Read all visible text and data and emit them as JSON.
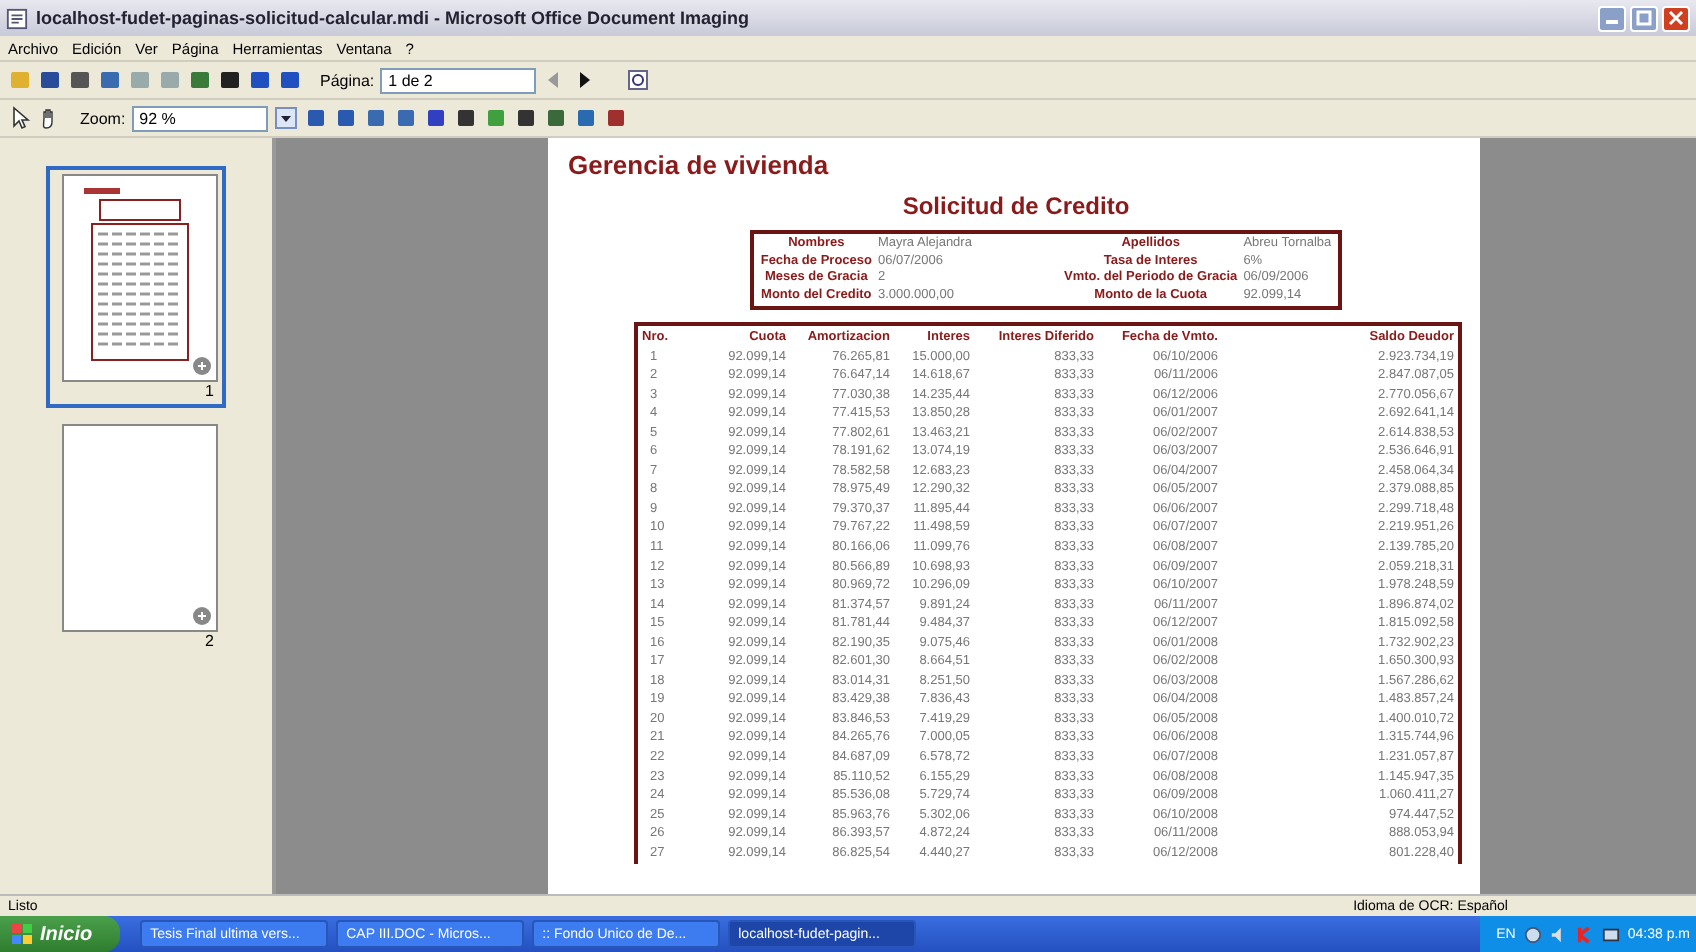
{
  "window": {
    "title": "localhost-fudet-paginas-solicitud-calcular.mdi - Microsoft Office Document Imaging"
  },
  "menu": [
    "Archivo",
    "Edición",
    "Ver",
    "Página",
    "Herramientas",
    "Ventana",
    "?"
  ],
  "toolbar": {
    "page_label": "Página:",
    "page_value": "1 de 2",
    "zoom_label": "Zoom:",
    "zoom_value": "92 %"
  },
  "thumbnails": [
    {
      "label": "1",
      "selected": true
    },
    {
      "label": "2",
      "selected": false
    }
  ],
  "document": {
    "heading": "Gerencia de vivienda",
    "title": "Solicitud de Credito",
    "fields": [
      {
        "label": "Nombres",
        "value": "Mayra Alejandra"
      },
      {
        "label": "Apellidos",
        "value": "Abreu Tornalba"
      },
      {
        "label": "Fecha de Proceso",
        "value": "06/07/2006"
      },
      {
        "label": "Tasa de Interes",
        "value": "6%"
      },
      {
        "label": "Meses de Gracia",
        "value": "2"
      },
      {
        "label": "Vmto. del Periodo de Gracia",
        "value": "06/09/2006"
      },
      {
        "label": "Monto del Credito",
        "value": "3.000.000,00"
      },
      {
        "label": "Monto de la Cuota",
        "value": "92.099,14"
      }
    ],
    "table": {
      "columns": [
        "Nro.",
        "Cuota",
        "Amortizacion",
        "Interes",
        "Interes Diferido",
        "Fecha de Vmto.",
        "Saldo Deudor"
      ],
      "rows": [
        [
          "1",
          "92.099,14",
          "76.265,81",
          "15.000,00",
          "833,33",
          "06/10/2006",
          "2.923.734,19"
        ],
        [
          "2",
          "92.099,14",
          "76.647,14",
          "14.618,67",
          "833,33",
          "06/11/2006",
          "2.847.087,05"
        ],
        [
          "3",
          "92.099,14",
          "77.030,38",
          "14.235,44",
          "833,33",
          "06/12/2006",
          "2.770.056,67"
        ],
        [
          "4",
          "92.099,14",
          "77.415,53",
          "13.850,28",
          "833,33",
          "06/01/2007",
          "2.692.641,14"
        ],
        [
          "5",
          "92.099,14",
          "77.802,61",
          "13.463,21",
          "833,33",
          "06/02/2007",
          "2.614.838,53"
        ],
        [
          "6",
          "92.099,14",
          "78.191,62",
          "13.074,19",
          "833,33",
          "06/03/2007",
          "2.536.646,91"
        ],
        [
          "7",
          "92.099,14",
          "78.582,58",
          "12.683,23",
          "833,33",
          "06/04/2007",
          "2.458.064,34"
        ],
        [
          "8",
          "92.099,14",
          "78.975,49",
          "12.290,32",
          "833,33",
          "06/05/2007",
          "2.379.088,85"
        ],
        [
          "9",
          "92.099,14",
          "79.370,37",
          "11.895,44",
          "833,33",
          "06/06/2007",
          "2.299.718,48"
        ],
        [
          "10",
          "92.099,14",
          "79.767,22",
          "11.498,59",
          "833,33",
          "06/07/2007",
          "2.219.951,26"
        ],
        [
          "11",
          "92.099,14",
          "80.166,06",
          "11.099,76",
          "833,33",
          "06/08/2007",
          "2.139.785,20"
        ],
        [
          "12",
          "92.099,14",
          "80.566,89",
          "10.698,93",
          "833,33",
          "06/09/2007",
          "2.059.218,31"
        ],
        [
          "13",
          "92.099,14",
          "80.969,72",
          "10.296,09",
          "833,33",
          "06/10/2007",
          "1.978.248,59"
        ],
        [
          "14",
          "92.099,14",
          "81.374,57",
          "9.891,24",
          "833,33",
          "06/11/2007",
          "1.896.874,02"
        ],
        [
          "15",
          "92.099,14",
          "81.781,44",
          "9.484,37",
          "833,33",
          "06/12/2007",
          "1.815.092,58"
        ],
        [
          "16",
          "92.099,14",
          "82.190,35",
          "9.075,46",
          "833,33",
          "06/01/2008",
          "1.732.902,23"
        ],
        [
          "17",
          "92.099,14",
          "82.601,30",
          "8.664,51",
          "833,33",
          "06/02/2008",
          "1.650.300,93"
        ],
        [
          "18",
          "92.099,14",
          "83.014,31",
          "8.251,50",
          "833,33",
          "06/03/2008",
          "1.567.286,62"
        ],
        [
          "19",
          "92.099,14",
          "83.429,38",
          "7.836,43",
          "833,33",
          "06/04/2008",
          "1.483.857,24"
        ],
        [
          "20",
          "92.099,14",
          "83.846,53",
          "7.419,29",
          "833,33",
          "06/05/2008",
          "1.400.010,72"
        ],
        [
          "21",
          "92.099,14",
          "84.265,76",
          "7.000,05",
          "833,33",
          "06/06/2008",
          "1.315.744,96"
        ],
        [
          "22",
          "92.099,14",
          "84.687,09",
          "6.578,72",
          "833,33",
          "06/07/2008",
          "1.231.057,87"
        ],
        [
          "23",
          "92.099,14",
          "85.110,52",
          "6.155,29",
          "833,33",
          "06/08/2008",
          "1.145.947,35"
        ],
        [
          "24",
          "92.099,14",
          "85.536,08",
          "5.729,74",
          "833,33",
          "06/09/2008",
          "1.060.411,27"
        ],
        [
          "25",
          "92.099,14",
          "85.963,76",
          "5.302,06",
          "833,33",
          "06/10/2008",
          "974.447,52"
        ],
        [
          "26",
          "92.099,14",
          "86.393,57",
          "4.872,24",
          "833,33",
          "06/11/2008",
          "888.053,94"
        ],
        [
          "27",
          "92.099,14",
          "86.825,54",
          "4.440,27",
          "833,33",
          "06/12/2008",
          "801.228,40"
        ]
      ]
    }
  },
  "status_bar": {
    "left": "Listo",
    "right": "Idioma de OCR: Español"
  },
  "taskbar": {
    "start": "Inicio",
    "tasks": [
      {
        "label": "Tesis Final ultima vers...",
        "selected": false
      },
      {
        "label": "CAP III.DOC - Micros...",
        "selected": false
      },
      {
        "label": ":: Fondo Unico de De...",
        "selected": false
      },
      {
        "label": "localhost-fudet-pagin...",
        "selected": true
      }
    ],
    "language": "EN",
    "clock": "04:38 p.m"
  }
}
